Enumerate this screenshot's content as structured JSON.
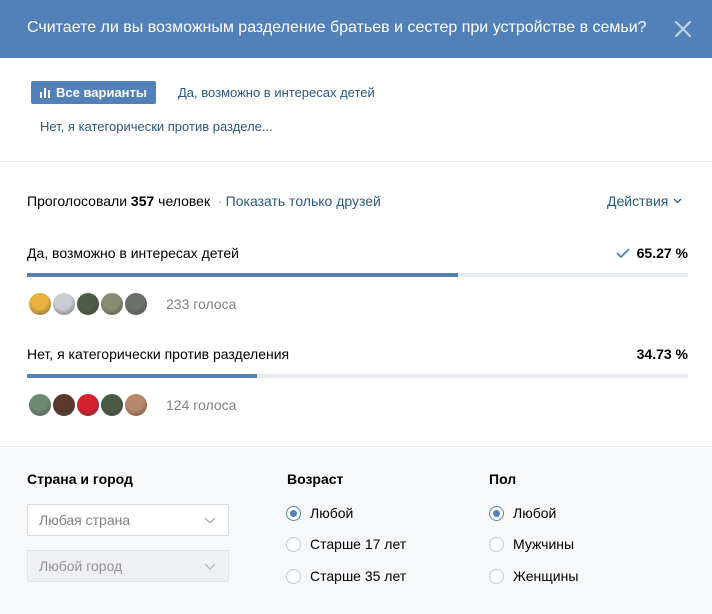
{
  "header": {
    "title": "Считаете ли вы возможным разделение братьев и сестер при устройстве в семьи?"
  },
  "filters": {
    "all_label": "Все варианты",
    "option_links": [
      "Да, возможно в интересах детей",
      "Нет, я категорически против разделе..."
    ]
  },
  "summary": {
    "voted_prefix": "Проголосовали",
    "voted_count": "357",
    "voted_suffix": "человек",
    "separator": "·",
    "friends_link": "Показать только друзей",
    "actions_label": "Действия"
  },
  "options": [
    {
      "label": "Да, возможно в интересах детей",
      "percent_text": "65.27 %",
      "percent": 65.27,
      "selected": true,
      "votes_text": "233 голоса",
      "avatar_colors": [
        "#e9b13f",
        "#c9ccd2",
        "#4e5b47",
        "#8c8a70",
        "#6c6f6c"
      ]
    },
    {
      "label": "Нет, я категорически против разделения",
      "percent_text": "34.73 %",
      "percent": 34.73,
      "selected": false,
      "votes_text": "124 голоса",
      "avatar_colors": [
        "#6f8a70",
        "#5a3a2c",
        "#d4212c",
        "#4a5a42",
        "#b9876a"
      ]
    }
  ],
  "bottom": {
    "location": {
      "title": "Страна и город",
      "country_placeholder": "Любая страна",
      "city_placeholder": "Любой город"
    },
    "age": {
      "title": "Возраст",
      "options": [
        "Любой",
        "Старше 17 лет",
        "Старше 35 лет"
      ],
      "selected_index": 0
    },
    "gender": {
      "title": "Пол",
      "options": [
        "Любой",
        "Мужчины",
        "Женщины"
      ],
      "selected_index": 0
    }
  },
  "colors": {
    "accent": "#5181b8",
    "link": "#2a5885",
    "muted": "#828282"
  },
  "icons": {
    "close": "close-icon",
    "all_variants": "bar-chart-icon",
    "actions": "chevron-down-icon",
    "selected_option": "checkmark-icon"
  }
}
